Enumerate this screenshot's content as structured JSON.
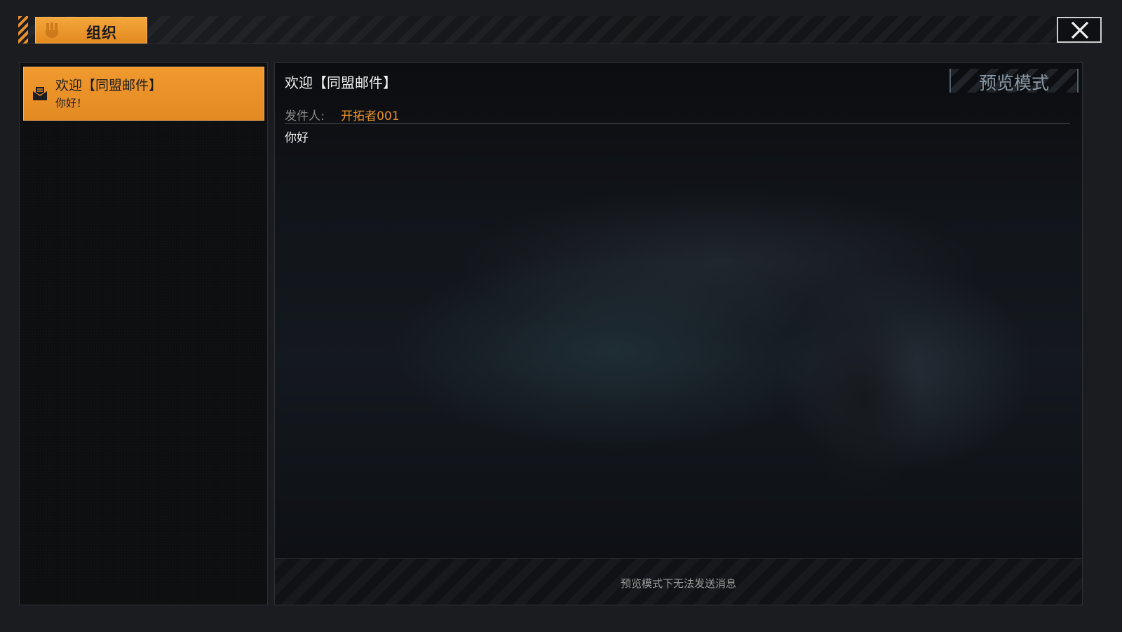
{
  "header": {
    "tab_label": "组织",
    "tab_icon": "organization-icon",
    "close_icon": "close-icon"
  },
  "mail_list": {
    "items": [
      {
        "title": "欢迎【同盟邮件】",
        "preview": "你好！",
        "icon": "envelope-icon"
      }
    ]
  },
  "mail_detail": {
    "subject": "欢迎【同盟邮件】",
    "mode_badge": "预览模式",
    "sender_label": "发件人:",
    "sender_name": "开拓者001",
    "body": "你好",
    "footer_notice": "预览模式下无法发送消息"
  },
  "colors": {
    "accent": "#e8912a",
    "background": "#1a1c20",
    "panel": "#0d0e10"
  }
}
